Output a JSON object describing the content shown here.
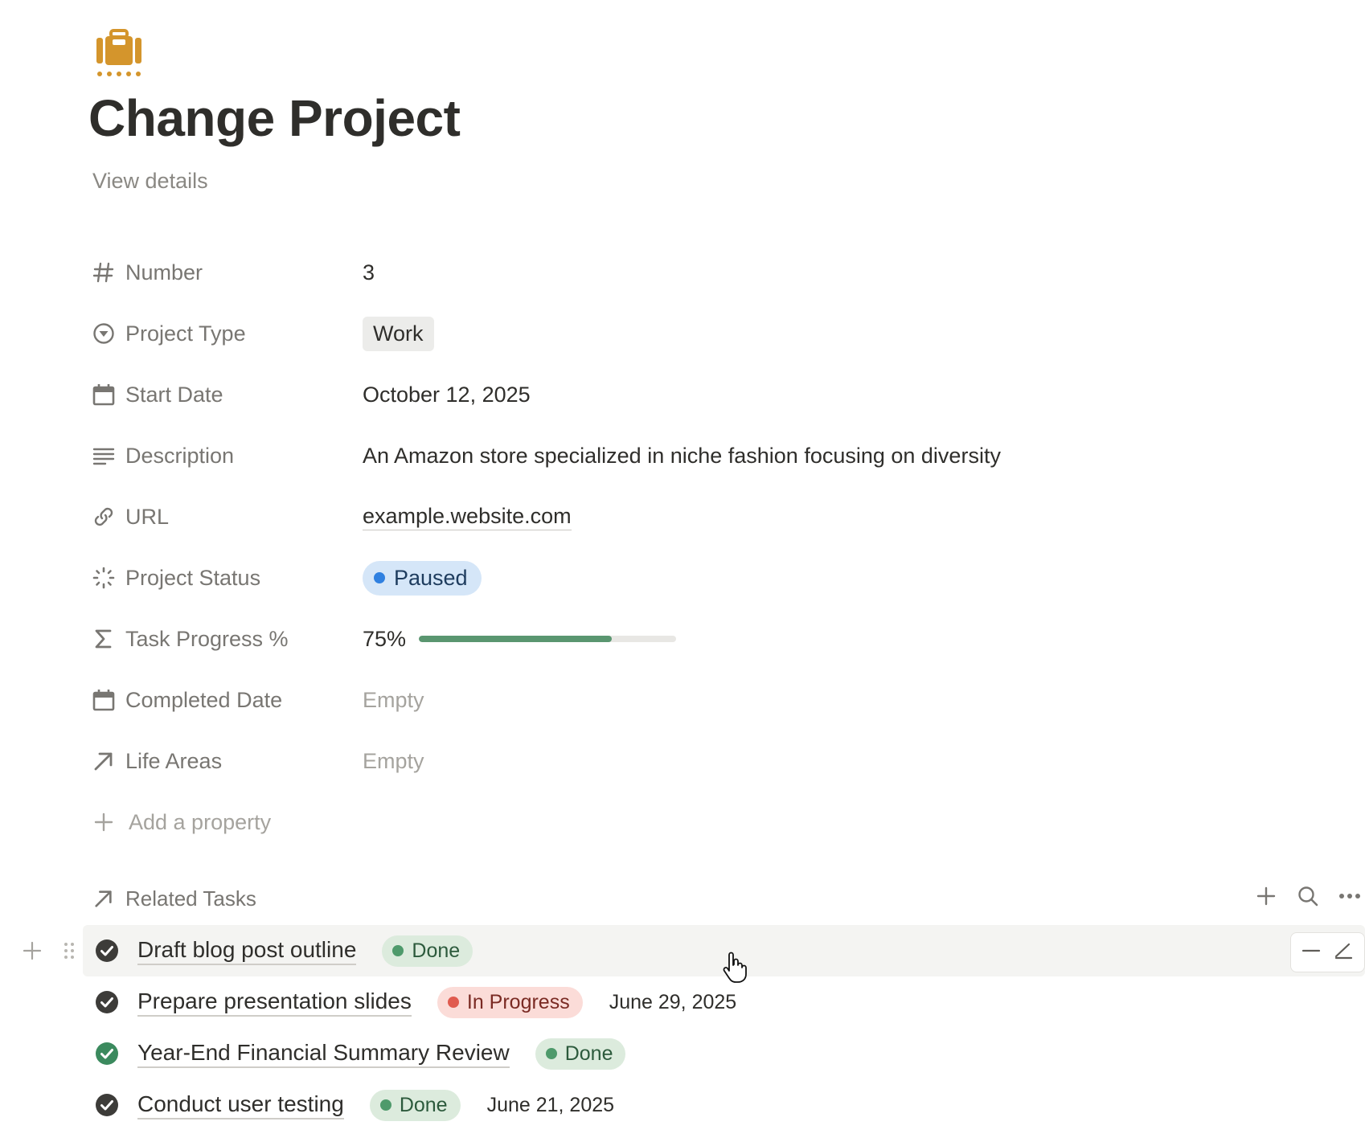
{
  "page": {
    "icon": "suitcase-icon",
    "icon_color": "#d4952c",
    "title": "Change Project",
    "view_details": "View details"
  },
  "properties": [
    {
      "icon": "number-icon",
      "label": "Number",
      "value": "3"
    },
    {
      "icon": "select-icon",
      "label": "Project Type",
      "value": "Work"
    },
    {
      "icon": "calendar-icon",
      "label": "Start Date",
      "value": "October 12, 2025"
    },
    {
      "icon": "text-lines-icon",
      "label": "Description",
      "value": "An Amazon store specialized in niche fashion focusing on diversity"
    },
    {
      "icon": "link-icon",
      "label": "URL",
      "value": "example.website.com"
    },
    {
      "icon": "status-icon",
      "label": "Project Status",
      "value": "Paused",
      "dot_color": "#2f80e0",
      "bg": "#d5e6f8"
    },
    {
      "icon": "sigma-icon",
      "label": "Task Progress %",
      "value": "75%",
      "progress": 0.75,
      "bar_color": "#5a9670"
    },
    {
      "icon": "calendar-icon",
      "label": "Completed Date",
      "value": "Empty"
    },
    {
      "icon": "relation-arrow-icon",
      "label": "Life Areas",
      "value": "Empty"
    }
  ],
  "add_property": "Add a property",
  "related": {
    "title": "Related Tasks",
    "actions": [
      "plus-icon",
      "search-icon",
      "more-icon"
    ],
    "tasks": [
      {
        "name": "Draft blog post outline",
        "status": "Done",
        "status_color": "#4e9a6b",
        "status_bg": "#dcebdd",
        "status_text": "#2c5a3c",
        "date": "",
        "check_color": "#3d3c39"
      },
      {
        "name": "Prepare presentation slides",
        "status": "In Progress",
        "status_color": "#e05b4f",
        "status_bg": "#fbdcd8",
        "status_text": "#7a2a23",
        "date": "June 29, 2025",
        "check_color": "#3d3c39"
      },
      {
        "name": "Year-End Financial Summary Review",
        "status": "Done",
        "status_color": "#4e9a6b",
        "status_bg": "#dcebdd",
        "status_text": "#2c5a3c",
        "date": "",
        "check_color": "#3b8a5e"
      },
      {
        "name": "Conduct user testing",
        "status": "Done",
        "status_color": "#4e9a6b",
        "status_bg": "#dcebdd",
        "status_text": "#2c5a3c",
        "date": "June 21, 2025",
        "check_color": "#3d3c39"
      }
    ]
  }
}
